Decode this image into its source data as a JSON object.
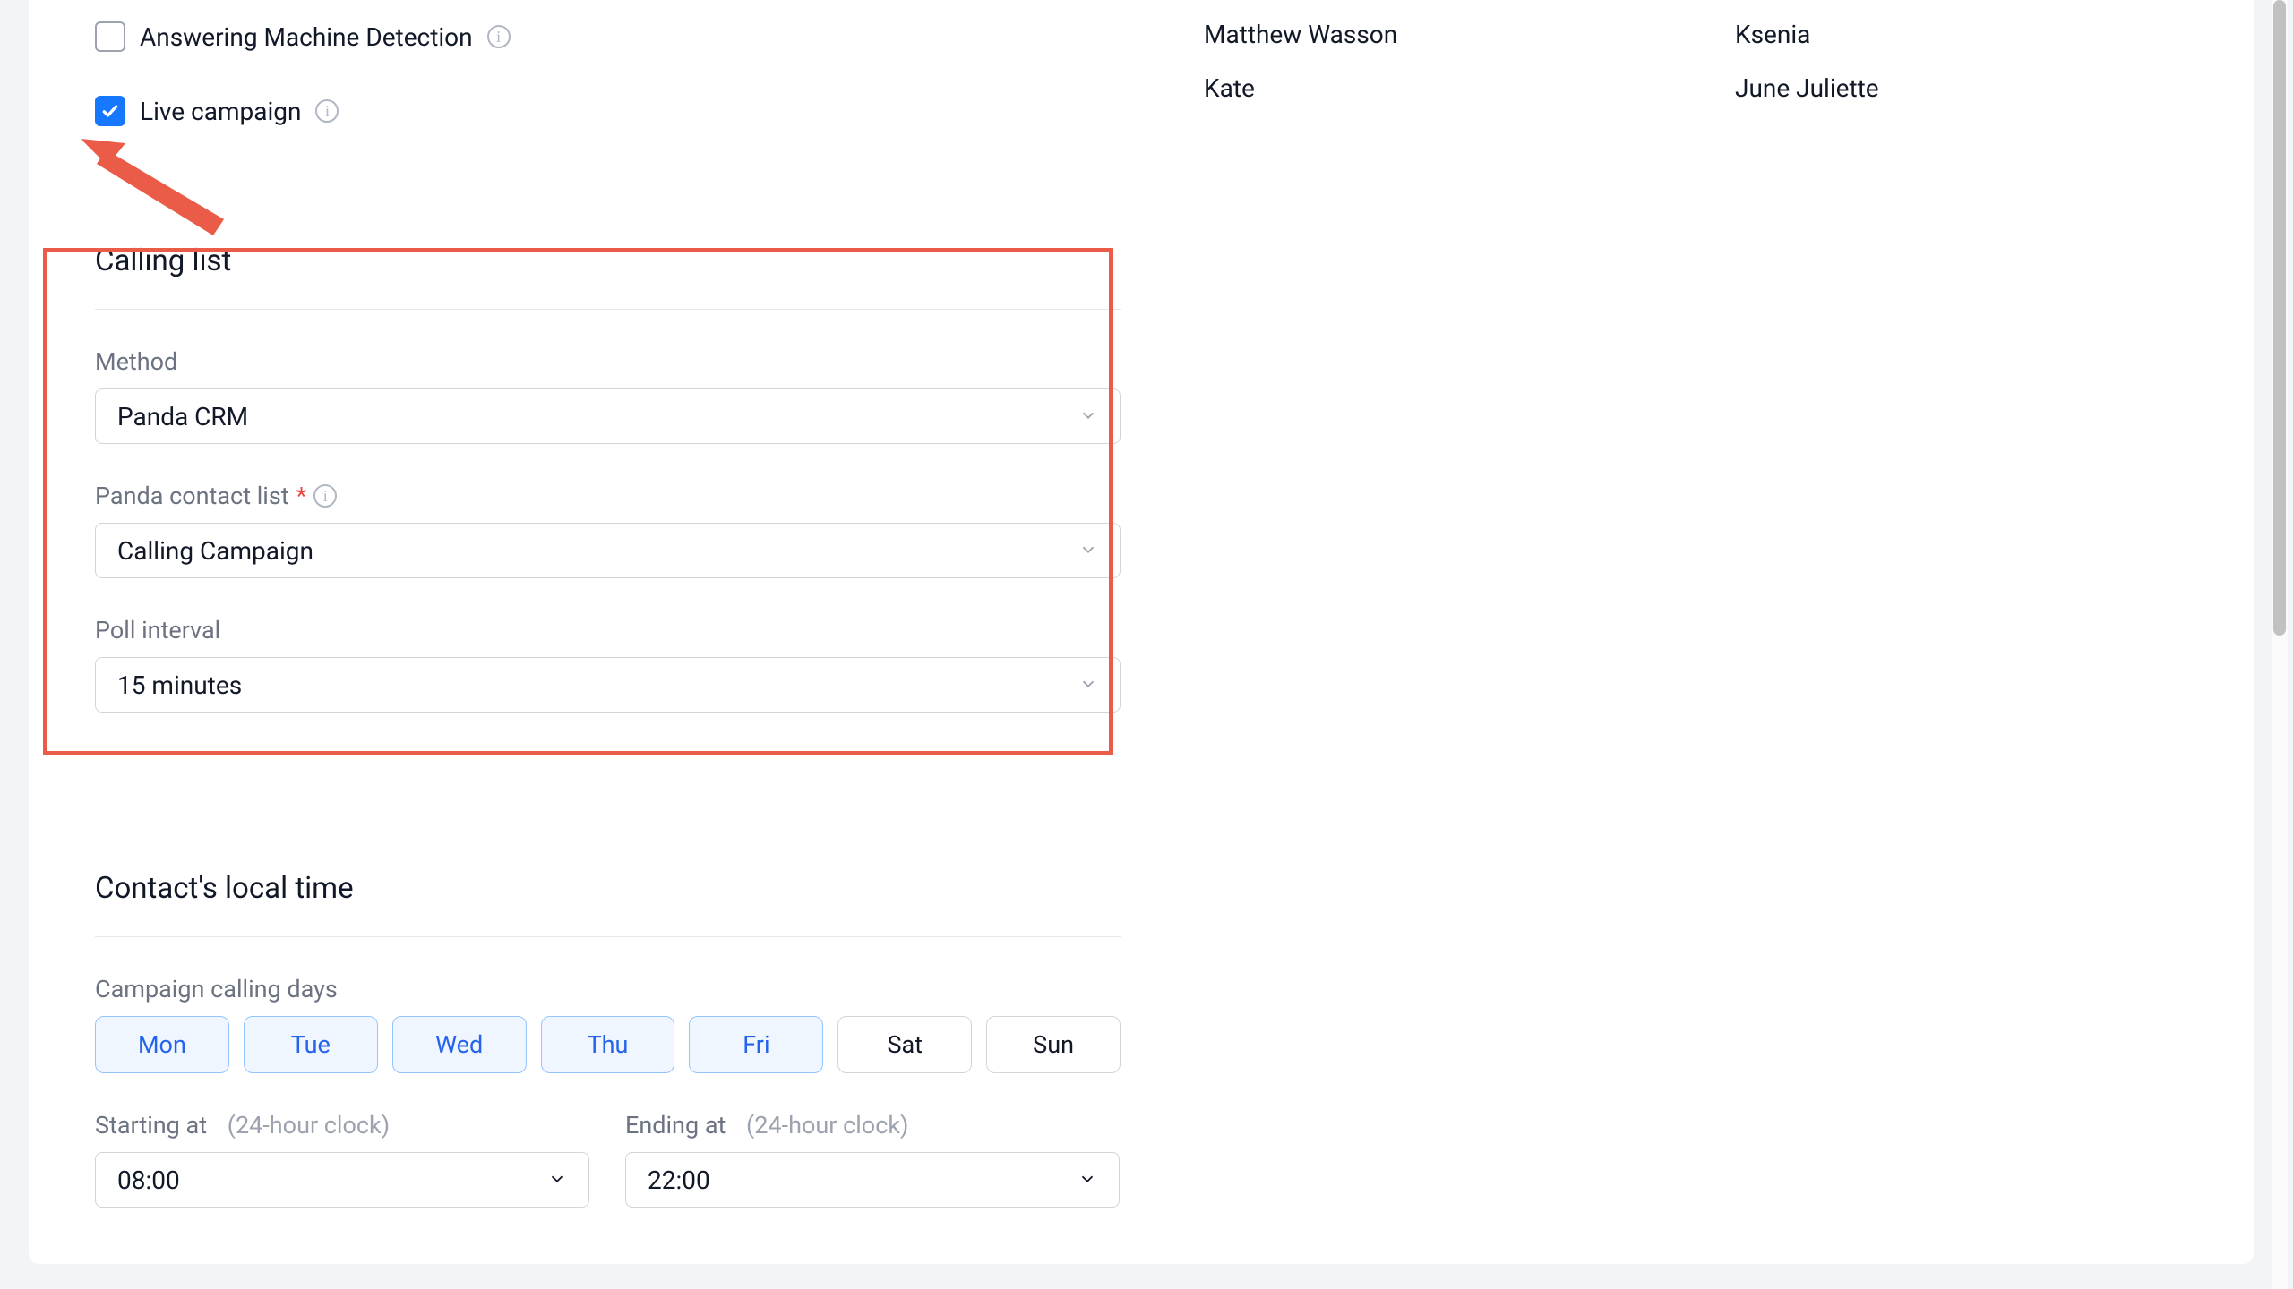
{
  "checkboxes": {
    "amd_label": "Answering Machine Detection",
    "live_label": "Live campaign"
  },
  "calling_list": {
    "title": "Calling list",
    "method_label": "Method",
    "method_value": "Panda CRM",
    "contact_list_label": "Panda contact list",
    "contact_list_value": "Calling Campaign",
    "poll_label": "Poll interval",
    "poll_value": "15 minutes"
  },
  "local_time": {
    "title": "Contact's local time",
    "days_label": "Campaign calling days",
    "days": [
      "Mon",
      "Tue",
      "Wed",
      "Thu",
      "Fri",
      "Sat",
      "Sun"
    ],
    "days_active": [
      true,
      true,
      true,
      true,
      true,
      false,
      false
    ],
    "start_label": "Starting at",
    "end_label": "Ending at",
    "clock_note": "(24-hour clock)",
    "start_value": "08:00",
    "end_value": "22:00"
  },
  "people": {
    "col1": [
      "Matthew Wasson",
      "Kate"
    ],
    "col2": [
      "Ksenia",
      "June Juliette"
    ]
  },
  "annotation": {
    "color": "#ea5c47"
  }
}
